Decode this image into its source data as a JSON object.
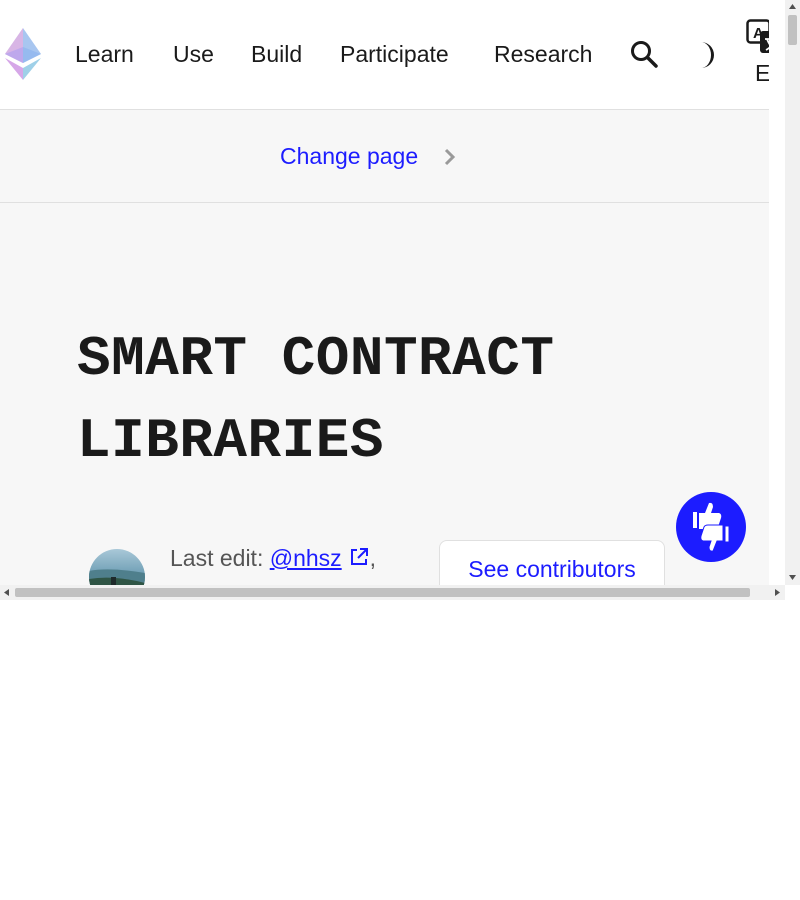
{
  "nav": {
    "logo_icon": "ethereum-logo-icon",
    "items": [
      {
        "label": "Learn"
      },
      {
        "label": "Use"
      },
      {
        "label": "Build"
      },
      {
        "label": "Participate"
      },
      {
        "label": "Research"
      }
    ],
    "search_icon": "search-icon",
    "theme_icon": "dark-mode-toggle-icon",
    "language_icon": "translate-icon",
    "language_label": "EN"
  },
  "subnav": {
    "change_page_label": "Change page",
    "chevron_icon": "chevron-right-icon"
  },
  "main": {
    "title": "SMART CONTRACT LIBRARIES",
    "last_edit_prefix": "Last edit: ",
    "last_edit_user": "@nhsz",
    "last_edit_suffix": ",",
    "external_link_icon": "external-link-icon",
    "see_contributors_label": "See contributors"
  },
  "feedback": {
    "icon": "thumbs-up-down-icon"
  },
  "colors": {
    "accent": "#1c1cff",
    "text": "#1a1a1a",
    "page_background": "#f7f7f7",
    "header_background": "#ffffff"
  }
}
